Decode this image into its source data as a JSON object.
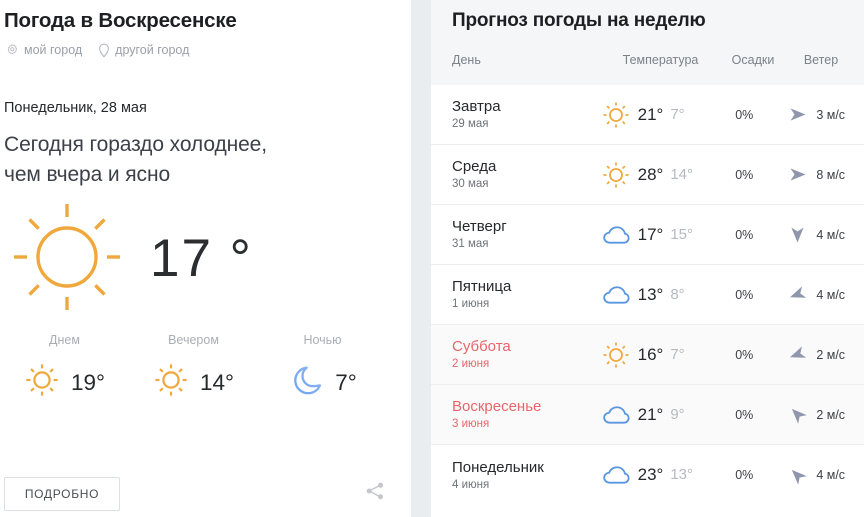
{
  "left": {
    "city_title": "Погода в Воскресенске",
    "links": [
      {
        "label": "мой город",
        "icon": "gear-icon"
      },
      {
        "label": "другой город",
        "icon": "location-pin-icon"
      }
    ],
    "date_line": "Понедельник, 28 мая",
    "headline_line1": "Сегодня гораздо холоднее,",
    "headline_line2": "чем вчера и ясно",
    "current": {
      "icon": "sun-icon",
      "temp": "17 °"
    },
    "dayparts": [
      {
        "label": "Днем",
        "icon": "sun-icon",
        "temp": "19°"
      },
      {
        "label": "Вечером",
        "icon": "sun-icon",
        "temp": "14°"
      },
      {
        "label": "Ночью",
        "icon": "moon-icon",
        "temp": "7°"
      }
    ],
    "details_button": "ПОДРОБНО",
    "share_icon": "share-icon"
  },
  "right": {
    "title": "Прогноз погоды на неделю",
    "columns": {
      "day": "День",
      "temperature": "Температура",
      "precipitation": "Осадки",
      "wind": "Ветер"
    },
    "rows": [
      {
        "day": "Завтра",
        "date": "29 мая",
        "weekend": false,
        "icon": "sun-icon",
        "temp_day": "21°",
        "temp_night": "7°",
        "precip": "0%",
        "wind": "3 м/с",
        "wind_dir_deg": 90,
        "wind_icon": "wind-arrow-icon"
      },
      {
        "day": "Среда",
        "date": "30 мая",
        "weekend": false,
        "icon": "sun-icon",
        "temp_day": "28°",
        "temp_night": "14°",
        "precip": "0%",
        "wind": "8 м/с",
        "wind_dir_deg": 90,
        "wind_icon": "wind-arrow-icon"
      },
      {
        "day": "Четверг",
        "date": "31 мая",
        "weekend": false,
        "icon": "cloud-icon",
        "temp_day": "17°",
        "temp_night": "15°",
        "precip": "0%",
        "wind": "4 м/с",
        "wind_dir_deg": 180,
        "wind_icon": "wind-arrow-icon"
      },
      {
        "day": "Пятница",
        "date": "1 июня",
        "weekend": false,
        "icon": "cloud-icon",
        "temp_day": "13°",
        "temp_night": "8°",
        "precip": "0%",
        "wind": "4 м/с",
        "wind_dir_deg": 250,
        "wind_icon": "wind-arrow-icon"
      },
      {
        "day": "Суббота",
        "date": "2 июня",
        "weekend": true,
        "icon": "sun-icon",
        "temp_day": "16°",
        "temp_night": "7°",
        "precip": "0%",
        "wind": "2 м/с",
        "wind_dir_deg": 250,
        "wind_icon": "wind-arrow-icon"
      },
      {
        "day": "Воскресенье",
        "date": "3 июня",
        "weekend": true,
        "icon": "cloud-icon",
        "temp_day": "21°",
        "temp_night": "9°",
        "precip": "0%",
        "wind": "2 м/с",
        "wind_dir_deg": 315,
        "wind_icon": "wind-arrow-icon"
      },
      {
        "day": "Понедельник",
        "date": "4 июня",
        "weekend": false,
        "icon": "cloud-icon",
        "temp_day": "23°",
        "temp_night": "13°",
        "precip": "0%",
        "wind": "4 м/с",
        "wind_dir_deg": 315,
        "wind_icon": "wind-arrow-icon"
      }
    ]
  },
  "colors": {
    "sun": "#f0a83c",
    "cloud": "#5b97e0",
    "moon": "#6c9ce8",
    "weekend_text": "#e8656b",
    "wind_arrow": "#9096ac",
    "gutter": "#e9edf0",
    "panel_header": "#f5f6f8"
  }
}
